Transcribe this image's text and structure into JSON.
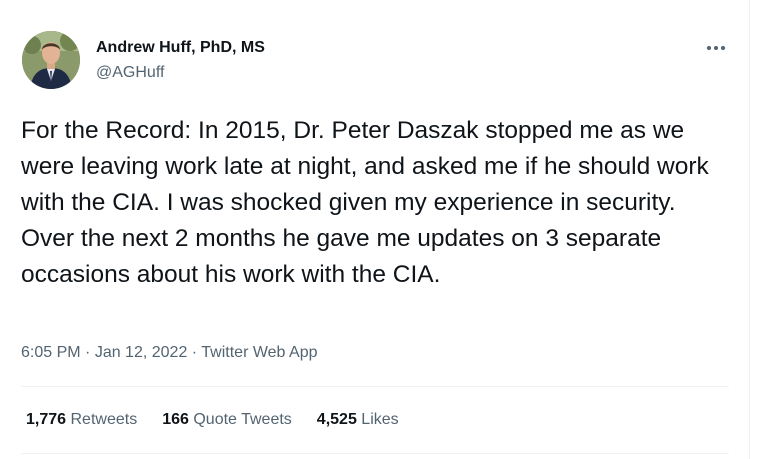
{
  "author": {
    "name": "Andrew Huff, PhD, MS",
    "handle": "@AGHuff",
    "avatar_icon": "profile-avatar"
  },
  "menu": {
    "icon": "more-horizontal-icon",
    "glyph": "•••"
  },
  "tweet": {
    "text": "For the Record: In 2015, Dr. Peter Daszak stopped me as we were leaving work late at night, and asked me if he should work with the CIA. I was shocked given my experience in security. Over the next 2 months he gave me updates on 3 separate occasions about his work with the CIA."
  },
  "meta": {
    "time": "6:05 PM",
    "separator": " · ",
    "date": "Jan 12, 2022",
    "source": "Twitter Web App"
  },
  "stats": {
    "retweets_count": "1,776",
    "retweets_label": "Retweets",
    "quotes_count": "166",
    "quotes_label": "Quote Tweets",
    "likes_count": "4,525",
    "likes_label": "Likes"
  },
  "colors": {
    "text": "#0f1419",
    "secondary": "#536471",
    "divider": "#eff3f4"
  }
}
